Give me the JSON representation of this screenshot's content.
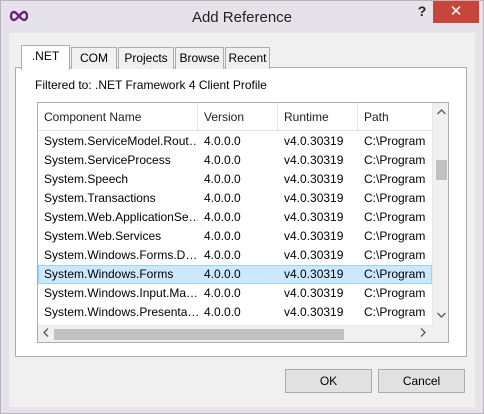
{
  "window": {
    "title": "Add Reference",
    "help_label": "?",
    "close_label": "✕"
  },
  "tabs": [
    {
      "label": ".NET",
      "active": true
    },
    {
      "label": "COM",
      "active": false
    },
    {
      "label": "Projects",
      "active": false
    },
    {
      "label": "Browse",
      "active": false
    },
    {
      "label": "Recent",
      "active": false
    }
  ],
  "filter_text": "Filtered to: .NET Framework 4 Client Profile",
  "list": {
    "columns": [
      "Component Name",
      "Version",
      "Runtime",
      "Path"
    ],
    "rows": [
      {
        "name": "System.ServiceModel.Rout…",
        "version": "4.0.0.0",
        "runtime": "v4.0.30319",
        "path": "C:\\Program"
      },
      {
        "name": "System.ServiceProcess",
        "version": "4.0.0.0",
        "runtime": "v4.0.30319",
        "path": "C:\\Program"
      },
      {
        "name": "System.Speech",
        "version": "4.0.0.0",
        "runtime": "v4.0.30319",
        "path": "C:\\Program"
      },
      {
        "name": "System.Transactions",
        "version": "4.0.0.0",
        "runtime": "v4.0.30319",
        "path": "C:\\Program"
      },
      {
        "name": "System.Web.ApplicationSe…",
        "version": "4.0.0.0",
        "runtime": "v4.0.30319",
        "path": "C:\\Program"
      },
      {
        "name": "System.Web.Services",
        "version": "4.0.0.0",
        "runtime": "v4.0.30319",
        "path": "C:\\Program"
      },
      {
        "name": "System.Windows.Forms.D…",
        "version": "4.0.0.0",
        "runtime": "v4.0.30319",
        "path": "C:\\Program"
      },
      {
        "name": "System.Windows.Forms",
        "version": "4.0.0.0",
        "runtime": "v4.0.30319",
        "path": "C:\\Program",
        "selected": true
      },
      {
        "name": "System.Windows.Input.Ma…",
        "version": "4.0.0.0",
        "runtime": "v4.0.30319",
        "path": "C:\\Program"
      },
      {
        "name": "System.Windows.Presenta…",
        "version": "4.0.0.0",
        "runtime": "v4.0.30319",
        "path": "C:\\Program"
      }
    ]
  },
  "buttons": {
    "ok": "OK",
    "cancel": "Cancel"
  },
  "colors": {
    "selection": "#cce8ff",
    "close": "#c7463c"
  },
  "icons": {
    "app": "infinity-icon",
    "scroll_up": "chevron-up-icon",
    "scroll_down": "chevron-down-icon",
    "scroll_left": "chevron-left-icon",
    "scroll_right": "chevron-right-icon"
  }
}
